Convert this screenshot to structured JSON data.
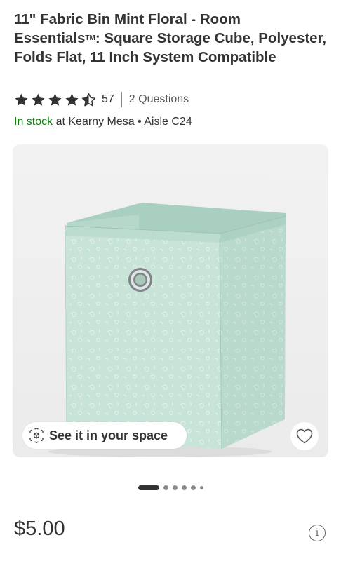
{
  "product": {
    "title_main": "11\" Fabric Bin Mint Floral - Room Essentials",
    "title_trademark": "TM",
    "title_rest": ": Square Storage Cube, Polyester, Folds Flat, 11 Inch System Compatible"
  },
  "rating": {
    "stars_value": 4.5,
    "stars_max": 5,
    "count": "57",
    "questions": "2 Questions"
  },
  "availability": {
    "status": "In stock",
    "location": " at Kearny Mesa • Aisle C24"
  },
  "gallery": {
    "ar_label": "See it in your space",
    "ar_icon": "ar-cube-icon",
    "favorite_icon": "heart-icon",
    "pages_total": 6,
    "current_page": 1
  },
  "price": {
    "amount": "$5.00",
    "info_icon": "info-icon",
    "info_glyph": "i"
  },
  "colors": {
    "in_stock": "#008300",
    "text": "#333333",
    "bin_mint": "#c8e3d8"
  }
}
